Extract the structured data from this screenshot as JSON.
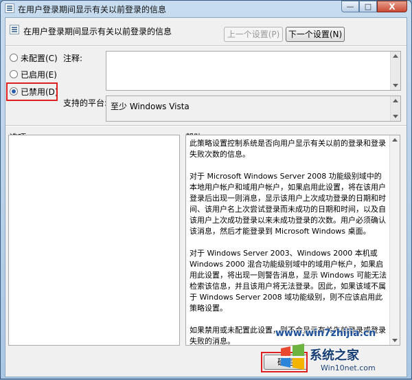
{
  "window": {
    "title": "在用户登录期间显示有关以前登录的信息",
    "controls": {
      "minimize": "—",
      "maximize": "□",
      "close": "X"
    }
  },
  "header": {
    "policy_title": "在用户登录期间显示有关以前登录的信息",
    "prev_button": "上一个设置(P)",
    "next_button": "下一个设置(N)"
  },
  "state": {
    "options": [
      {
        "label": "未配置(C)",
        "selected": false
      },
      {
        "label": "已启用(E)",
        "selected": false
      },
      {
        "label": "已禁用(D)",
        "selected": true
      }
    ]
  },
  "comment": {
    "label": "注释:",
    "value": ""
  },
  "platform": {
    "label": "支持的平台:",
    "value": "至少 Windows Vista"
  },
  "options_pane": {
    "label": "选项:"
  },
  "help_pane": {
    "label": "帮助:",
    "paragraphs": [
      "此策略设置控制系统是否向用户显示有关以前的登录和登录失败次数的信息。",
      "对于 Microsoft Windows Server 2008 功能级别域中的本地用户帐户和域用户帐户，如果启用此设置，将在该用户登录后出现一则消息，显示该用户上次成功登录的日期和时间、该用户名上次尝试登录而未成功的日期和时间，以及自该用户上次成功登录以来未成功登录的次数。用户必须确认该消息，然后才能登录到 Microsoft Windows 桌面。",
      "对于 Windows Server 2003、Windows 2000 本机或 Windows 2000 混合功能级别域中的域用户帐户，如果启用此设置，将出现一则警告消息，显示 Windows 可能无法检索该信息，并且该用户将无法登录。因此，如果该域不属于 Windows Server 2008 域功能级别，则不应该启用此策略设置。",
      "如果禁用或未配置此设置，则不会显示有关先前登录或登录失败的消息。"
    ]
  },
  "footer": {
    "ok_button": "确定"
  },
  "watermark": {
    "line1": "www.win7zhijia.cn",
    "brand": "系统之家",
    "url": "Win10net.com"
  },
  "colors": {
    "highlight": "#e02020",
    "accent": "#2a5fa8"
  }
}
